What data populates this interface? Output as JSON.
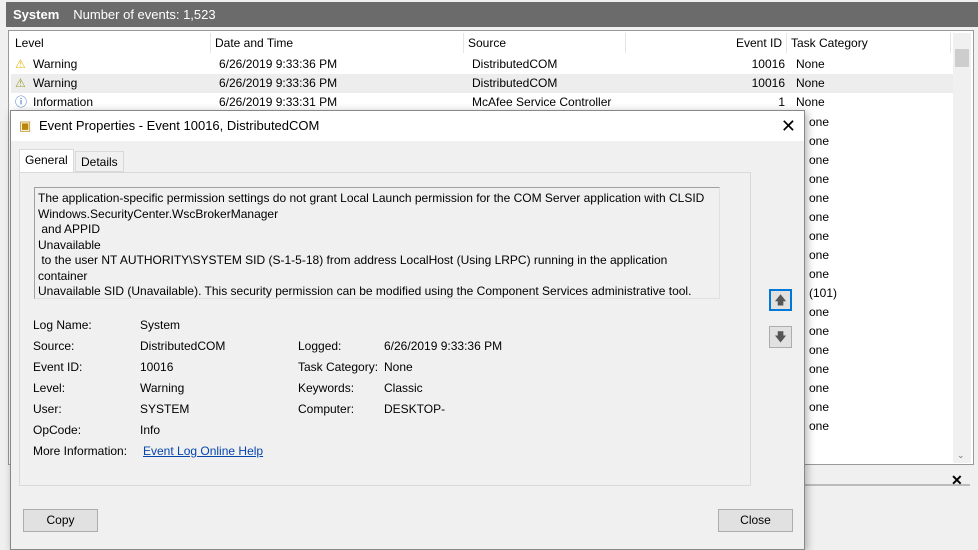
{
  "topbar": {
    "log": "System",
    "count": "Number of events: 1,523"
  },
  "columns": [
    "Level",
    "Date and Time",
    "Source",
    "Event ID",
    "Task Category"
  ],
  "rows": [
    {
      "level": "Warning",
      "date": "6/26/2019 9:33:36 PM",
      "source": "DistributedCOM",
      "id": "10016",
      "task": "None"
    },
    {
      "level": "Warning",
      "date": "6/26/2019 9:33:36 PM",
      "source": "DistributedCOM",
      "id": "10016",
      "task": "None"
    },
    {
      "level": "Information",
      "date": "6/26/2019 9:33:31 PM",
      "source": "McAfee Service Controller",
      "id": "1",
      "task": "None"
    }
  ],
  "partial_tasks": [
    "one",
    "one",
    "one",
    "one",
    "one",
    "one",
    "one",
    "one",
    "one",
    "(101)",
    "one",
    "one",
    "one",
    "one",
    "one",
    "one",
    "one"
  ],
  "dialog": {
    "title": "Event Properties - Event 10016, DistributedCOM",
    "tabs": [
      "General",
      "Details"
    ],
    "message": "The application-specific permission settings do not grant Local Launch permission for the COM Server application with CLSID\nWindows.SecurityCenter.WscBrokerManager\n and APPID\nUnavailable\n to the user NT AUTHORITY\\SYSTEM SID (S-1-5-18) from address LocalHost (Using LRPC) running in the application container\nUnavailable SID (Unavailable). This security permission can be modified using the Component Services administrative tool.",
    "fields": {
      "log_name_label": "Log Name:",
      "log_name": "System",
      "source_label": "Source:",
      "source": "DistributedCOM",
      "event_id_label": "Event ID:",
      "event_id": "10016",
      "level_label": "Level:",
      "level": "Warning",
      "user_label": "User:",
      "user": "SYSTEM",
      "opcode_label": "OpCode:",
      "opcode": "Info",
      "more_info_label": "More Information:",
      "more_info_link": "Event Log Online Help",
      "logged_label": "Logged:",
      "logged": "6/26/2019 9:33:36 PM",
      "task_label": "Task Category:",
      "task": "None",
      "keywords_label": "Keywords:",
      "keywords": "Classic",
      "computer_label": "Computer:",
      "computer": "DESKTOP-"
    },
    "copy": "Copy",
    "close": "Close"
  }
}
